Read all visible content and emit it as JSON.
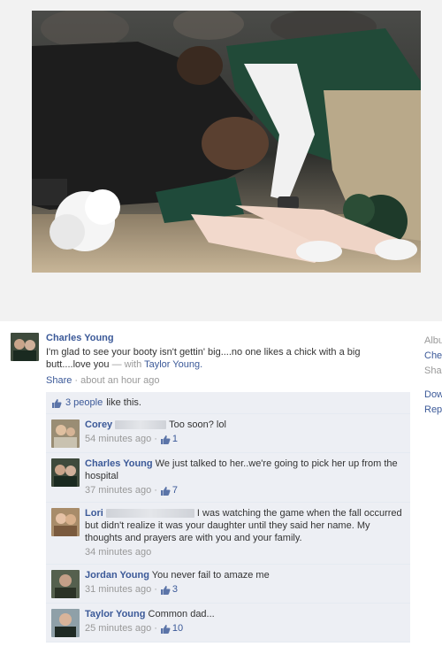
{
  "post": {
    "author": "Charles Young",
    "text_main": "I'm glad to see your booty isn't gettin' big....no one likes a chick with a big butt....love you",
    "with_prefix": "— with",
    "tagged": "Taylor Young.",
    "share": "Share",
    "meta_sep": "·",
    "time": "about an hour ago"
  },
  "likes": {
    "text": "3 people",
    "suffix": "like this."
  },
  "comments": [
    {
      "name": "Corey",
      "text": "Too soon? lol",
      "time": "54 minutes ago",
      "sep": "·",
      "likes": "1"
    },
    {
      "name": "Charles Young",
      "text": "We just talked to her..we're going to pick her up from the hospital",
      "time": "37 minutes ago",
      "sep": "·",
      "likes": "7"
    },
    {
      "name": "Lori",
      "text": "I was watching the game when the fall occurred but didn't realize it was your daughter until they said her name. My thoughts and prayers are with you and your family.",
      "time": "34 minutes ago",
      "sep": "",
      "likes": ""
    },
    {
      "name": "Jordan Young",
      "text": "You never fail to amaze me",
      "time": "31 minutes ago",
      "sep": "·",
      "likes": "3"
    },
    {
      "name": "Taylor Young",
      "text": "Common dad...",
      "time": "25 minutes ago",
      "sep": "·",
      "likes": "10"
    }
  ],
  "sidebar": {
    "items": [
      "Albu",
      "Che",
      "Sha",
      "Dow",
      "Rep"
    ]
  },
  "colors": {
    "link": "#3b5998",
    "ufi_bg": "#edeff4",
    "meta": "#999999"
  }
}
